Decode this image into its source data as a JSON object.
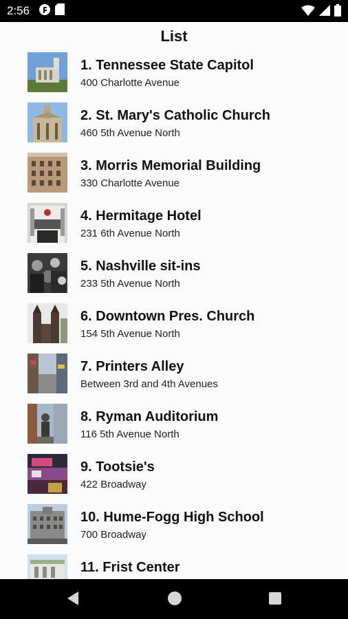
{
  "status_bar": {
    "time": "2:56",
    "icons": [
      "app-f-icon",
      "sd-card-icon",
      "wifi-icon",
      "signal-icon",
      "battery-icon"
    ]
  },
  "header": {
    "title": "List"
  },
  "items": [
    {
      "number": "1.",
      "name": "Tennessee State Capitol",
      "address": "400 Charlotte Avenue"
    },
    {
      "number": "2.",
      "name": "St. Mary's Catholic Church",
      "address": "460 5th Avenue North"
    },
    {
      "number": "3.",
      "name": "Morris Memorial Building",
      "address": "330 Charlotte Avenue"
    },
    {
      "number": "4.",
      "name": "Hermitage Hotel",
      "address": "231 6th Avenue North"
    },
    {
      "number": "5.",
      "name": "Nashville sit-ins",
      "address": "233 5th Avenue North"
    },
    {
      "number": "6.",
      "name": "Downtown Pres. Church",
      "address": "154 5th Avenue North"
    },
    {
      "number": "7.",
      "name": "Printers Alley",
      "address": "Between 3rd and 4th Avenues"
    },
    {
      "number": "8.",
      "name": "Ryman Auditorium",
      "address": "116 5th Avenue North"
    },
    {
      "number": "9.",
      "name": "Tootsie's",
      "address": "422 Broadway"
    },
    {
      "number": "10.",
      "name": "Hume-Fogg High School",
      "address": "700 Broadway"
    },
    {
      "number": "11.",
      "name": "Frist Center",
      "address": ""
    }
  ],
  "nav_bar": {
    "buttons": [
      "back-icon",
      "home-icon",
      "recents-icon"
    ]
  }
}
